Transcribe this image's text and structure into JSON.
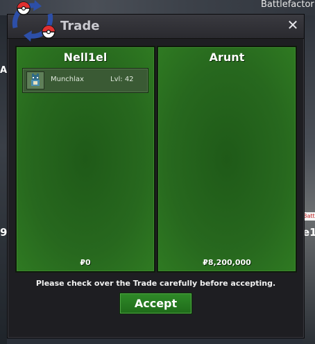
{
  "background": {
    "top_right_text": "Battlefactor",
    "right_badge": "Batt",
    "right_label": "e1",
    "left_label_top": "A",
    "left_label_bottom": "9"
  },
  "window": {
    "title": "Trade",
    "close_glyph": "✕",
    "logo_icon": "trade-arrows-pokeball-logo"
  },
  "trade": {
    "left": {
      "player": "Nell1el",
      "items": [
        {
          "name": "Munchlax",
          "level_text": "Lvl: 42",
          "icon": "munchlax-sprite-icon"
        }
      ],
      "money": "₽0"
    },
    "right": {
      "player": "Arunt",
      "items": [],
      "money": "₽8,200,000"
    }
  },
  "notice": "Please check over the Trade carefully before accepting.",
  "accept_label": "Accept",
  "colors": {
    "panel_green": "#27681e",
    "accept_green": "#2f8a28",
    "window_bg": "#1e1e22"
  }
}
